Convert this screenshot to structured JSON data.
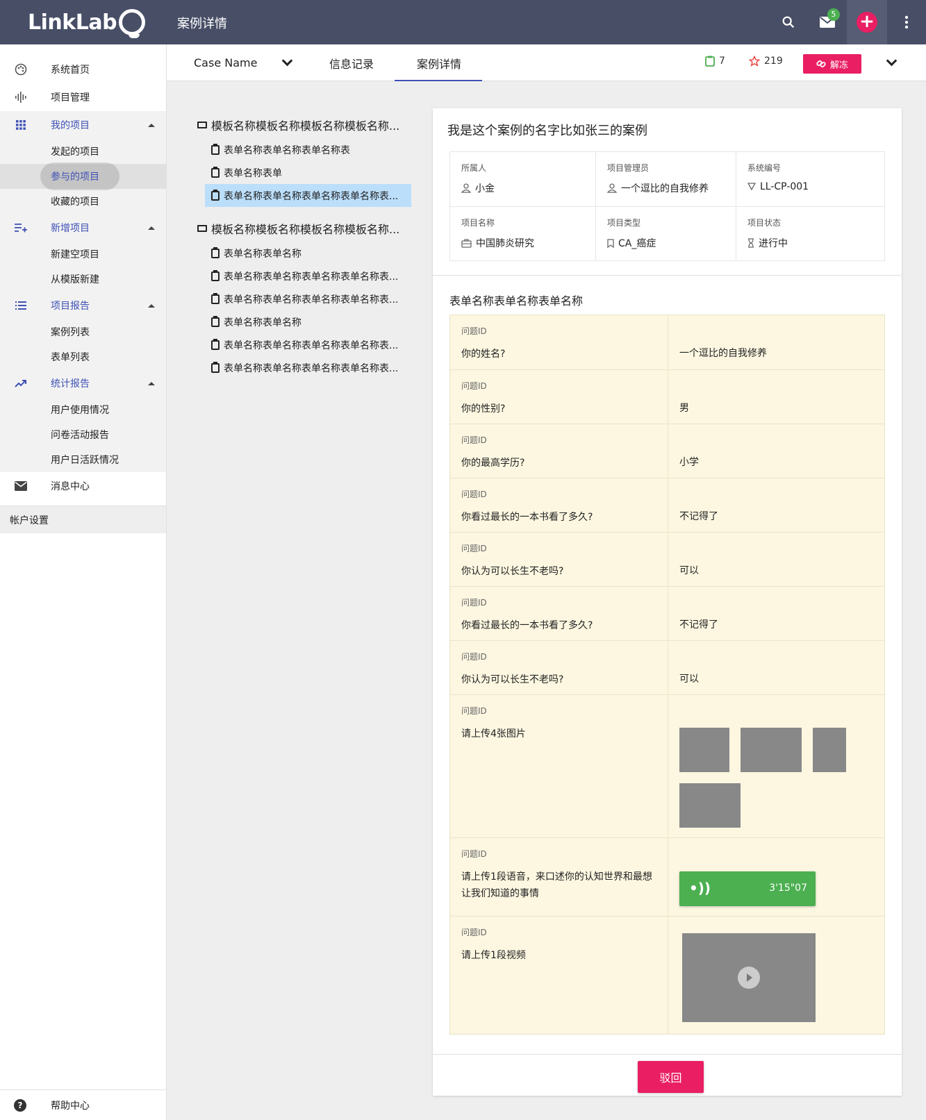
{
  "app": {
    "logo_text": "LinkLab",
    "page_title": "案例详情"
  },
  "topbar": {
    "mail_badge": "5"
  },
  "sidebar": {
    "home": "系统首页",
    "project_mgmt": "项目管理",
    "my_projects": {
      "label": "我的项目",
      "items": [
        "发起的项目",
        "参与的项目",
        "收藏的项目"
      ]
    },
    "new_project": {
      "label": "新增项目",
      "items": [
        "新建空项目",
        "从模版新建"
      ]
    },
    "project_report": {
      "label": "项目报告",
      "items": [
        "案例列表",
        "表单列表"
      ]
    },
    "stats_report": {
      "label": "统计报告",
      "items": [
        "用户使用情况",
        "问卷活动报告",
        "用户日活跃情况"
      ]
    },
    "messages": "消息中心",
    "account": "帐户设置",
    "help": "帮助中心"
  },
  "tabs": {
    "case_name": "Case Name",
    "info_records": "信息记录",
    "case_detail": "案例详情",
    "clipboard_count": "7",
    "star_count": "219",
    "unfreeze": "解冻"
  },
  "tree": {
    "folder1": {
      "label": "模板名称模板名称模板名称模板名称...",
      "forms": [
        "表单名称表单名称表单名称表",
        "表单名称表单",
        "表单名称表单名称表单名称表单名称表..."
      ]
    },
    "folder2": {
      "label": "模板名称模板名称模板名称模板名称...",
      "forms": [
        "表单名称表单名称",
        "表单名称表单名称表单名称表单名称表...",
        "表单名称表单名称表单名称表单名称表...",
        "表单名称表单名称",
        "表单名称表单名称表单名称表单名称表...",
        "表单名称表单名称表单名称表单名称表..."
      ]
    }
  },
  "case": {
    "title": "我是这个案例的名字比如张三的案例",
    "owner_label": "所属人",
    "owner": "小金",
    "manager_label": "项目管理员",
    "manager": "一个逗比的自我修养",
    "sysno_label": "系统编号",
    "sysno": "LL-CP-001",
    "pname_label": "项目名称",
    "pname": "中国肺炎研究",
    "ptype_label": "项目类型",
    "ptype": "CA_癌症",
    "pstatus_label": "项目状态",
    "pstatus": "进行中"
  },
  "form": {
    "title": "表单名称表单名称表单名称",
    "qid_label": "问题ID",
    "rows": [
      {
        "q": "你的姓名?",
        "a": "一个逗比的自我修养"
      },
      {
        "q": "你的性别?",
        "a": "男"
      },
      {
        "q": "你的最高学历?",
        "a": "小学"
      },
      {
        "q": "你看过最长的一本书看了多久?",
        "a": "不记得了"
      },
      {
        "q": "你认为可以长生不老吗?",
        "a": "可以"
      },
      {
        "q": "你看过最长的一本书看了多久?",
        "a": "不记得了"
      },
      {
        "q": "你认为可以长生不老吗?",
        "a": "可以"
      },
      {
        "q": "请上传4张图片",
        "a": ""
      },
      {
        "q": "请上传1段语音，来口述你的认知世界和最想让我们知道的事情",
        "a": "3'15\"07"
      },
      {
        "q": "请上传1段视频",
        "a": ""
      }
    ]
  },
  "actions": {
    "reject": "驳回"
  }
}
